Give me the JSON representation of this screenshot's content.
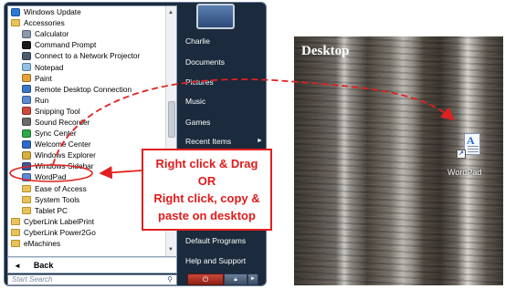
{
  "start_menu": {
    "programs": [
      {
        "label": "Windows Update",
        "icon": "windows-update-icon",
        "level": 0,
        "type": "app",
        "color": "#2a7ad8"
      },
      {
        "label": "Accessories",
        "icon": "folder-icon",
        "level": 0,
        "type": "folder"
      },
      {
        "label": "Calculator",
        "icon": "calculator-icon",
        "level": 1,
        "type": "app",
        "color": "#8a9aae"
      },
      {
        "label": "Command Prompt",
        "icon": "command-prompt-icon",
        "level": 1,
        "type": "app",
        "color": "#1a1a1a"
      },
      {
        "label": "Connect to a Network Projector",
        "icon": "projector-icon",
        "level": 1,
        "type": "app",
        "color": "#4a5a70"
      },
      {
        "label": "Notepad",
        "icon": "notepad-icon",
        "level": 1,
        "type": "app",
        "color": "#8fc0e8"
      },
      {
        "label": "Paint",
        "icon": "paint-icon",
        "level": 1,
        "type": "app",
        "color": "#e8a23a"
      },
      {
        "label": "Remote Desktop Connection",
        "icon": "remote-desktop-icon",
        "level": 1,
        "type": "app",
        "color": "#3a78c8"
      },
      {
        "label": "Run",
        "icon": "run-icon",
        "level": 1,
        "type": "app",
        "color": "#5a8ad0"
      },
      {
        "label": "Snipping Tool",
        "icon": "scissors-icon",
        "level": 1,
        "type": "app",
        "color": "#d04a3a"
      },
      {
        "label": "Sound Recorder",
        "icon": "microphone-icon",
        "level": 1,
        "type": "app",
        "color": "#6a6a6a"
      },
      {
        "label": "Sync Center",
        "icon": "sync-icon",
        "level": 1,
        "type": "app",
        "color": "#2ea84a"
      },
      {
        "label": "Welcome Center",
        "icon": "welcome-center-icon",
        "level": 1,
        "type": "app",
        "color": "#2a6ac8"
      },
      {
        "label": "Windows Explorer",
        "icon": "explorer-icon",
        "level": 1,
        "type": "app",
        "color": "#d8b040"
      },
      {
        "label": "Windows Sidebar",
        "icon": "sidebar-icon",
        "level": 1,
        "type": "app",
        "color": "#3a5aa0"
      },
      {
        "label": "WordPad",
        "icon": "wordpad-icon",
        "level": 1,
        "type": "app",
        "color": "#5a8ad8"
      },
      {
        "label": "Ease of Access",
        "icon": "folder-icon",
        "level": 1,
        "type": "folder"
      },
      {
        "label": "System Tools",
        "icon": "folder-icon",
        "level": 1,
        "type": "folder"
      },
      {
        "label": "Tablet PC",
        "icon": "folder-icon",
        "level": 1,
        "type": "folder"
      },
      {
        "label": "CyberLink LabelPrint",
        "icon": "folder-icon",
        "level": 0,
        "type": "folder"
      },
      {
        "label": "CyberLink Power2Go",
        "icon": "folder-icon",
        "level": 0,
        "type": "folder"
      },
      {
        "label": "eMachines",
        "icon": "folder-icon",
        "level": 0,
        "type": "folder"
      }
    ],
    "back_label": "Back",
    "search_placeholder": "Start Search",
    "right_items": [
      "Charlie",
      "Documents",
      "Pictures",
      "Music",
      "Games",
      "Recent Items",
      "Default Programs",
      "Help and Support"
    ],
    "power_icon": "power-icon",
    "lock_icon": "lock-icon"
  },
  "desktop": {
    "title": "Desktop",
    "icon_label": "WordPad"
  },
  "callout": {
    "lines": [
      "Right click & Drag",
      "OR",
      "Right click, copy &",
      "paste on desktop"
    ],
    "color": "#e21a1a"
  }
}
